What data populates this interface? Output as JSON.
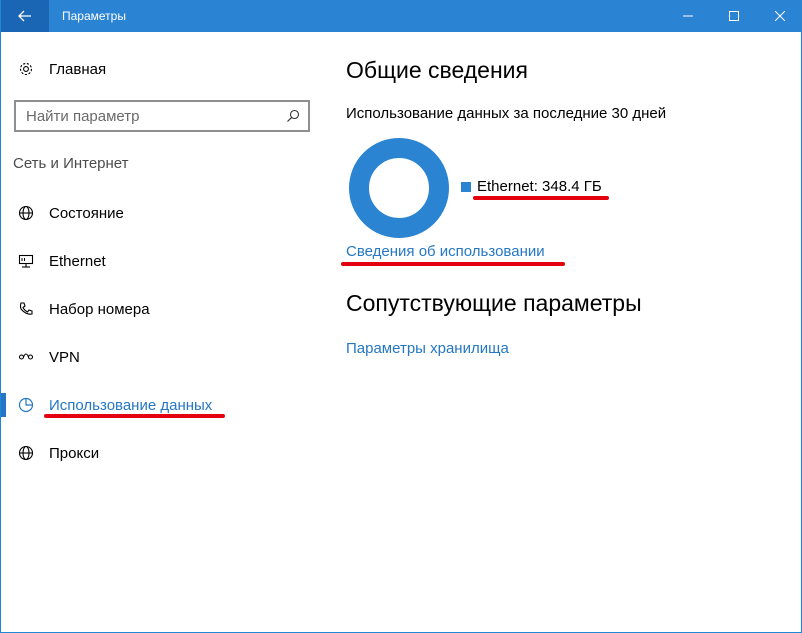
{
  "window": {
    "title": "Параметры"
  },
  "sidebar": {
    "home_label": "Главная",
    "search_placeholder": "Найти параметр",
    "section_label": "Сеть и Интернет",
    "items": [
      {
        "label": "Состояние",
        "icon": "globe-icon"
      },
      {
        "label": "Ethernet",
        "icon": "ethernet-icon"
      },
      {
        "label": "Набор номера",
        "icon": "dialup-icon"
      },
      {
        "label": "VPN",
        "icon": "vpn-icon"
      },
      {
        "label": "Использование данных",
        "icon": "data-usage-icon",
        "active": true
      },
      {
        "label": "Прокси",
        "icon": "proxy-globe-icon"
      }
    ]
  },
  "main": {
    "title": "Общие сведения",
    "usage_subtitle": "Использование данных за последние 30 дней",
    "legend_label": "Ethernet: 348.4 ГБ",
    "usage_details_link": "Сведения об использовании",
    "related_title": "Сопутствующие параметры",
    "storage_link": "Параметры хранилища"
  },
  "chart_data": {
    "type": "pie",
    "categories": [
      "Ethernet"
    ],
    "values": [
      348.4
    ],
    "unit": "ГБ"
  },
  "colors": {
    "accent": "#2577c4",
    "titlebar": "#2b83d4",
    "donut": "#2a84d2",
    "annotation": "#e3000f"
  }
}
